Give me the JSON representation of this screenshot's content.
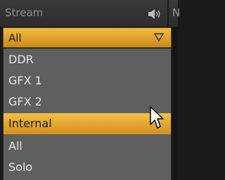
{
  "header": {
    "title": "Stream",
    "speaker_icon": "speaker-icon",
    "cut_letter": "N"
  },
  "select": {
    "value": "All",
    "arrow_icon": "triangle-down-icon"
  },
  "list": {
    "items": [
      {
        "label": "DDR"
      },
      {
        "label": "GFX 1"
      },
      {
        "label": "GFX 2"
      },
      {
        "label": "Internal",
        "selected": true
      },
      {
        "label": "All"
      },
      {
        "label": "Solo"
      }
    ]
  },
  "colors": {
    "accent": "#f0b33a",
    "list_bg": "#5f5f5f",
    "header_bg": "#333333"
  }
}
